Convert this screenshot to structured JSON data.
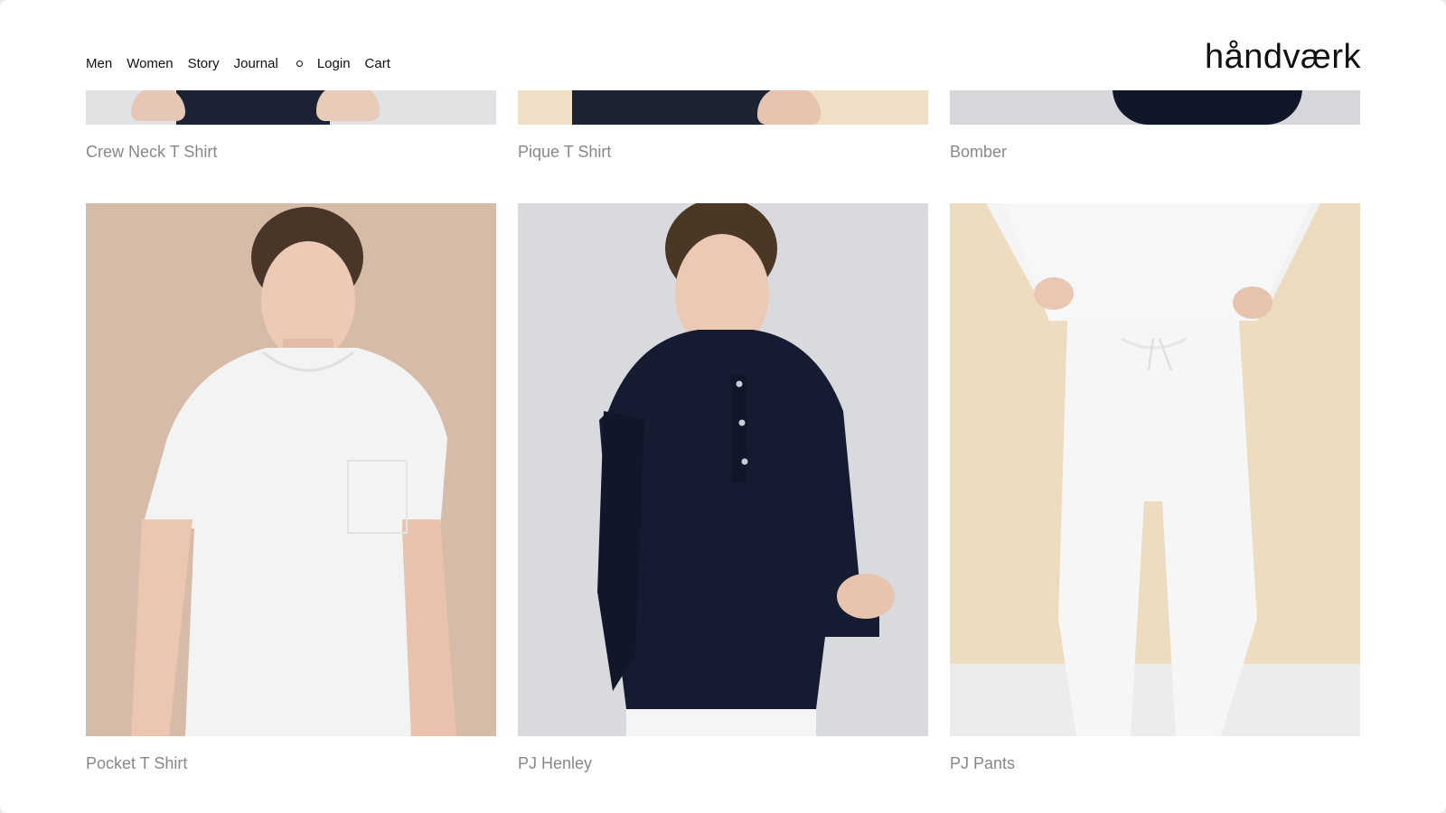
{
  "header": {
    "nav": {
      "men": "Men",
      "women": "Women",
      "story": "Story",
      "journal": "Journal",
      "login": "Login",
      "cart": "Cart"
    },
    "logo": "håndværk"
  },
  "products_row1": [
    {
      "name": "Crew Neck T Shirt",
      "bg": "#e2e2e4"
    },
    {
      "name": "Pique T Shirt",
      "bg": "#efdfc6"
    },
    {
      "name": "Bomber",
      "bg": "#d6d7da"
    }
  ],
  "products_row2": [
    {
      "name": "Pocket T Shirt",
      "bg": "#d6bba8"
    },
    {
      "name": "PJ Henley",
      "bg": "#d9dadd"
    },
    {
      "name": "PJ Pants",
      "bg": "#eddcc0"
    }
  ],
  "colors": {
    "text": "#111111",
    "label": "#888888",
    "navy": "#121a2e"
  }
}
